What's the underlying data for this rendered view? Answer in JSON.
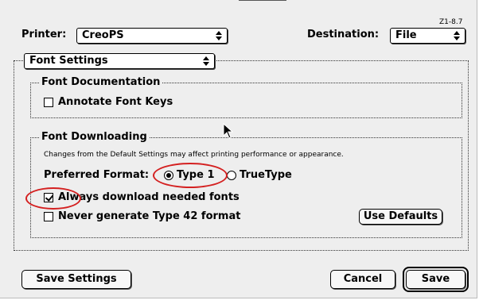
{
  "version_label": "Z1-8.7",
  "printer": {
    "label": "Printer:",
    "value": "CreoPS"
  },
  "destination": {
    "label": "Destination:",
    "value": "File"
  },
  "panel_select": {
    "value": "Font Settings"
  },
  "font_documentation": {
    "title": "Font Documentation",
    "annotate_label": "Annotate Font Keys",
    "annotate_checked": false
  },
  "font_downloading": {
    "title": "Font Downloading",
    "note": "Changes from the Default Settings may affect printing performance or appearance.",
    "preferred_format_label": "Preferred Format:",
    "options": [
      "Type 1",
      "TrueType"
    ],
    "selected_option": "Type 1",
    "always_download_label": "Always download needed fonts",
    "always_download_checked": true,
    "never_generate_label": "Never generate Type 42 format",
    "never_generate_checked": false,
    "use_defaults_label": "Use Defaults"
  },
  "buttons": {
    "save_settings": "Save Settings",
    "cancel": "Cancel",
    "save": "Save"
  },
  "colors": {
    "dialog_bg": "#eeeeee",
    "annotation": "#d42020"
  },
  "icons": [
    "popup-arrows-icon",
    "mouse-pointer-icon"
  ]
}
